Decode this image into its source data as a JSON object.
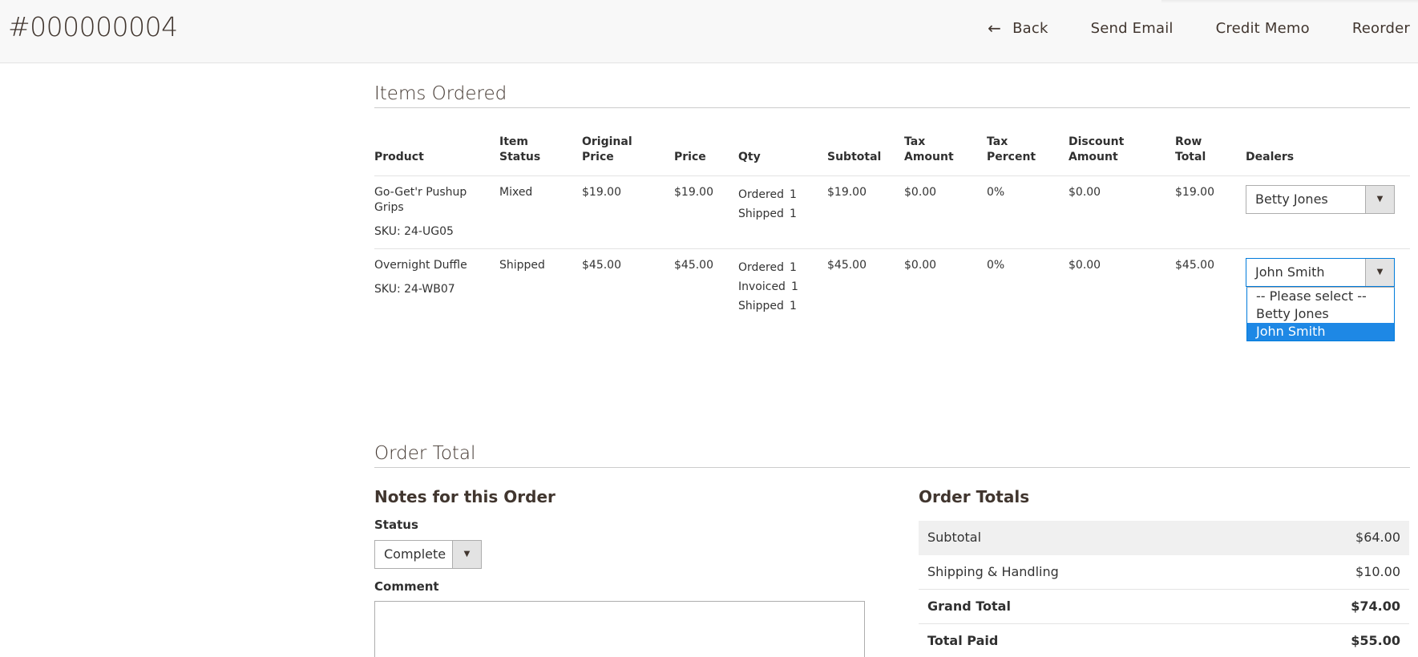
{
  "header": {
    "order_number": "#000000004",
    "actions": {
      "back": "Back",
      "send_email": "Send Email",
      "credit_memo": "Credit Memo",
      "reorder": "Reorder"
    },
    "back_icon": "arrow-left-icon"
  },
  "items_ordered": {
    "title": "Items Ordered",
    "columns": {
      "product": "Product",
      "item_status": [
        "Item",
        "Status"
      ],
      "original_price": [
        "Original",
        "Price"
      ],
      "price": "Price",
      "qty": "Qty",
      "subtotal": "Subtotal",
      "tax_amount": [
        "Tax",
        "Amount"
      ],
      "tax_percent": [
        "Tax",
        "Percent"
      ],
      "discount_amount": [
        "Discount",
        "Amount"
      ],
      "row_total": [
        "Row",
        "Total"
      ],
      "dealers": "Dealers"
    },
    "rows": [
      {
        "product_name": [
          "Go-Get'r Pushup",
          "Grips"
        ],
        "sku": "SKU: 24-UG05",
        "item_status": "Mixed",
        "original_price": "$19.00",
        "price": "$19.00",
        "qty": [
          {
            "label": "Ordered",
            "value": "1"
          },
          {
            "label": "Shipped",
            "value": "1"
          }
        ],
        "subtotal": "$19.00",
        "tax_amount": "$0.00",
        "tax_percent": "0%",
        "discount_amount": "$0.00",
        "row_total": "$19.00",
        "dealer": "Betty Jones"
      },
      {
        "product_name": [
          "Overnight Duffle"
        ],
        "sku": "SKU: 24-WB07",
        "item_status": "Shipped",
        "original_price": "$45.00",
        "price": "$45.00",
        "qty": [
          {
            "label": "Ordered",
            "value": "1"
          },
          {
            "label": "Invoiced",
            "value": "1"
          },
          {
            "label": "Shipped",
            "value": "1"
          }
        ],
        "subtotal": "$45.00",
        "tax_amount": "$0.00",
        "tax_percent": "0%",
        "discount_amount": "$0.00",
        "row_total": "$45.00",
        "dealer": "John Smith"
      }
    ],
    "dealer_options": [
      "-- Please select --",
      "Betty Jones",
      "John Smith"
    ],
    "dealer_dropdown_selected": "John Smith"
  },
  "order_total": {
    "title": "Order Total",
    "notes": {
      "title": "Notes for this Order",
      "status_label": "Status",
      "status_value": "Complete",
      "comment_label": "Comment",
      "comment_value": ""
    },
    "totals": {
      "title": "Order Totals",
      "subtotal_label": "Subtotal",
      "subtotal_value": "$64.00",
      "shipping_label": "Shipping & Handling",
      "shipping_value": "$10.00",
      "grand_total_label": "Grand Total",
      "grand_total_value": "$74.00",
      "total_paid_label": "Total Paid",
      "total_paid_value": "$55.00"
    }
  },
  "colors": {
    "header_bg": "#f8f8f8",
    "text_dark": "#41362f",
    "selected_option": "#1e88e5",
    "focus_border": "#007bdb"
  }
}
